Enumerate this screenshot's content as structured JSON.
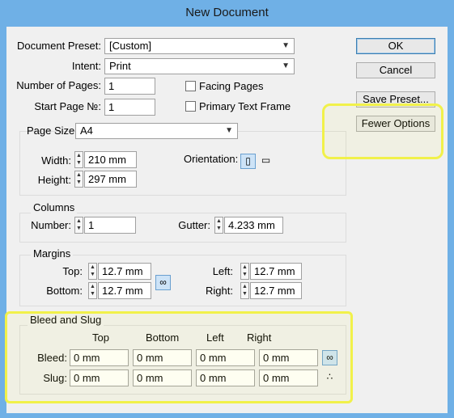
{
  "window": {
    "title": "New Document"
  },
  "preset": {
    "label": "Document Preset:",
    "value": "[Custom]"
  },
  "intent": {
    "label": "Intent:",
    "value": "Print"
  },
  "pages": {
    "number_label": "Number of Pages:",
    "number_value": "1",
    "start_label": "Start Page №:",
    "start_value": "1"
  },
  "options": {
    "facing_pages": "Facing Pages",
    "primary_text_frame": "Primary Text Frame"
  },
  "page_size": {
    "label": "Page Size:",
    "value": "A4",
    "width_label": "Width:",
    "width_value": "210 mm",
    "height_label": "Height:",
    "height_value": "297 mm",
    "orientation_label": "Orientation:"
  },
  "columns": {
    "title": "Columns",
    "number_label": "Number:",
    "number_value": "1",
    "gutter_label": "Gutter:",
    "gutter_value": "4.233 mm"
  },
  "margins": {
    "title": "Margins",
    "top_label": "Top:",
    "top_value": "12.7 mm",
    "bottom_label": "Bottom:",
    "bottom_value": "12.7 mm",
    "left_label": "Left:",
    "left_value": "12.7 mm",
    "right_label": "Right:",
    "right_value": "12.7 mm"
  },
  "bleed_slug": {
    "title": "Bleed and Slug",
    "headers": [
      "Top",
      "Bottom",
      "Left",
      "Right"
    ],
    "bleed_label": "Bleed:",
    "bleed_values": [
      "0 mm",
      "0 mm",
      "0 mm",
      "0 mm"
    ],
    "slug_label": "Slug:",
    "slug_values": [
      "0 mm",
      "0 mm",
      "0 mm",
      "0 mm"
    ]
  },
  "buttons": {
    "ok": "OK",
    "cancel": "Cancel",
    "save_preset": "Save Preset...",
    "fewer_options": "Fewer Options"
  },
  "colors": {
    "titlebar": "#6fb0e6",
    "dialog": "#f0f0f0",
    "highlight": "#f1f14a"
  }
}
